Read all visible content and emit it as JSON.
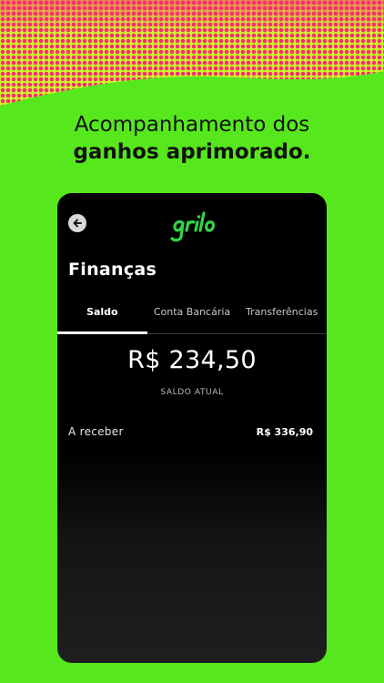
{
  "headline": {
    "line1": "Acompanhamento dos",
    "line2": "ganhos aprimorado."
  },
  "colors": {
    "background": "#56e81c",
    "pattern_dots": "#ff2a74",
    "pattern_base": "#c8ff2a",
    "phone_bg": "#000000",
    "logo_green": "#33d34a"
  },
  "app": {
    "logo_text": "grilo",
    "back_icon": "arrow-left-circle-icon",
    "title": "Finanças",
    "tabs": [
      {
        "label": "Saldo",
        "active": true
      },
      {
        "label": "Conta Bancária",
        "active": false
      },
      {
        "label": "Transferências",
        "active": false
      }
    ],
    "balance": "R$ 234,50",
    "balance_label": "SALDO ATUAL",
    "receivable": {
      "label": "A receber",
      "value": "R$ 336,90"
    }
  }
}
